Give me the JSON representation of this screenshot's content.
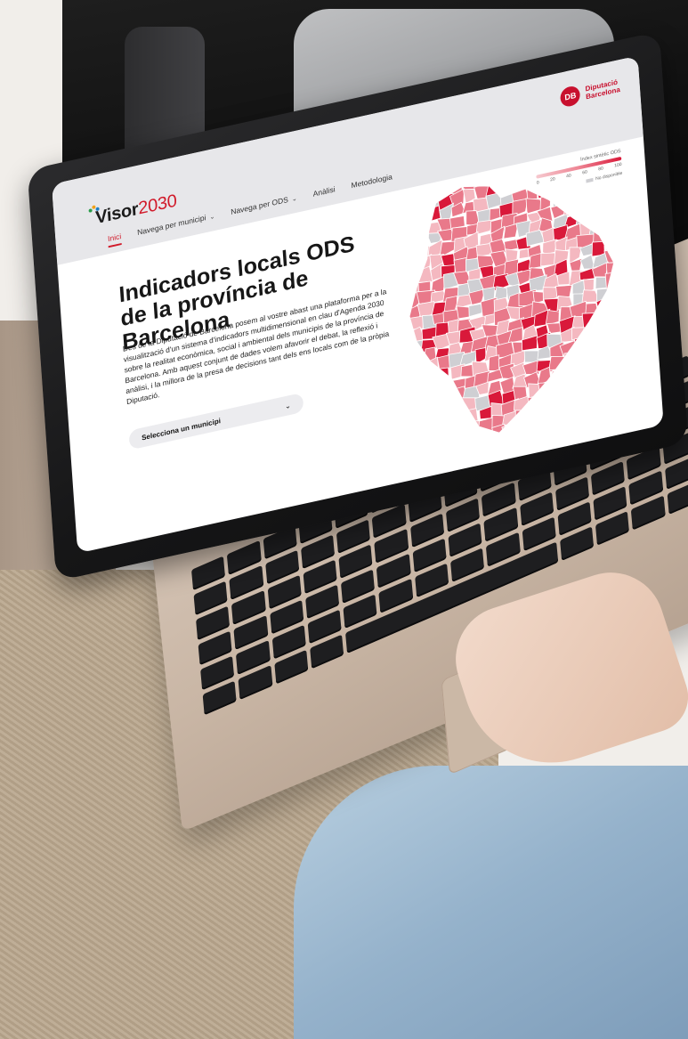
{
  "site": {
    "logo_bold": "Visor",
    "logo_accent": "2030",
    "nav": [
      {
        "label": "Inici",
        "has_chevron": false,
        "active": true
      },
      {
        "label": "Navega per municipi",
        "has_chevron": true,
        "active": false
      },
      {
        "label": "Navega per ODS",
        "has_chevron": true,
        "active": false
      },
      {
        "label": "Anàlisi",
        "has_chevron": false,
        "active": false
      },
      {
        "label": "Metodologia",
        "has_chevron": false,
        "active": false
      }
    ],
    "brand_line1": "Diputació",
    "brand_line2": "Barcelona",
    "brand_seal": "DB"
  },
  "hero": {
    "title": "Indicadors locals ODS de la província de Barcelona",
    "description": "Des de la Diputació de Barcelona posem al vostre abast una plataforma per a la visualització d'un sistema d'indicadors multidimensional en clau d'Agenda 2030 sobre la realitat econòmica, social i ambiental dels municipis de la província de Barcelona. Amb aquest conjunt de dades volem afavorir el debat, la reflexió i anàlisi, i la millora de la presa de decisions tant dels ens locals com de la pròpia Diputació.",
    "select_placeholder": "Selecciona un municipi"
  },
  "legend": {
    "title": "Índex sintètic ODS",
    "ticks": [
      "0",
      "20",
      "40",
      "60",
      "80",
      "100"
    ],
    "no_data": "No disponible"
  },
  "colors": {
    "accent": "#d11a2a",
    "brand": "#c8102e",
    "map_light": "#f4b8c0",
    "map_mid": "#e9798a",
    "map_dark": "#d9193a",
    "map_na": "#cfcfd3"
  },
  "icons": {
    "nav_chevron": "chevron-down-icon",
    "select_chevron": "chevron-down-icon",
    "brand": "diputacio-seal-icon",
    "logo": "visor-logo-mark-icon"
  }
}
